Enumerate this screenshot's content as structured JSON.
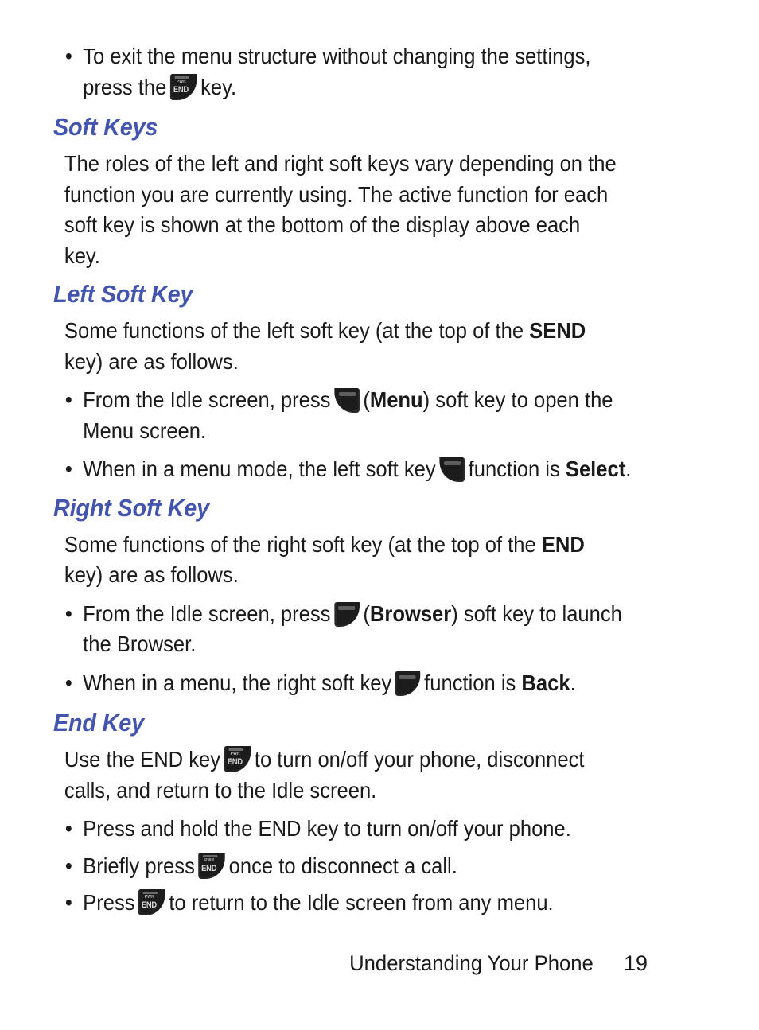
{
  "document": {
    "page_number": "19",
    "footer_title": "Understanding Your Phone",
    "heading_color": "#4455b0",
    "body_color": "#1a1a1a",
    "background_color": "#ffffff"
  },
  "intro_bullet": {
    "text_before": "To exit the menu structure without changing the settings, press the",
    "icon": "end-key-icon",
    "text_after": "key."
  },
  "sections": [
    {
      "id": "soft-keys",
      "heading": "Soft Keys",
      "paragraph": "The roles of the left and right soft keys vary depending on the function you are currently using. The active function for each soft key is shown at the bottom of the display above each key."
    },
    {
      "id": "left-soft-key",
      "heading": "Left Soft Key",
      "paragraph_part1": "Some functions of the left soft key (at the top of the ",
      "paragraph_bold": "SEND",
      "paragraph_part2": " key) are as follows.",
      "bullets": [
        {
          "text_before": "From the Idle screen, press",
          "icon": "left-soft-key-icon",
          "text_mid_open": "(",
          "bold": "Menu",
          "text_after": ") soft key to open the Menu screen."
        },
        {
          "text_before": "When in a menu mode, the left soft key",
          "icon": "left-soft-key-icon",
          "text_mid": "function is",
          "bold": "Select",
          "text_after": "."
        }
      ]
    },
    {
      "id": "right-soft-key",
      "heading": "Right Soft Key",
      "paragraph_part1": "Some functions of the right soft key (at the top of the ",
      "paragraph_bold": "END",
      "paragraph_part2": " key) are as follows.",
      "bullets": [
        {
          "text_before": "From the Idle screen, press",
          "icon": "right-soft-key-icon",
          "text_mid_open": "(",
          "bold": "Browser",
          "text_after": ") soft key to launch the Browser."
        },
        {
          "text_before": "When in a menu, the right soft key",
          "icon": "right-soft-key-icon",
          "text_mid": "function is",
          "bold": "Back",
          "text_after": "."
        }
      ]
    },
    {
      "id": "end-key",
      "heading": "End Key",
      "paragraph_part1": "Use the END key",
      "paragraph_icon": "end-key-icon",
      "paragraph_part2": "to turn on/off your phone, disconnect calls, and return to the Idle screen.",
      "bullets": [
        {
          "text_only": "Press and hold the END key to turn on/off your phone."
        },
        {
          "text_before": "Briefly press",
          "icon": "end-key-icon",
          "text_after": "once to disconnect a call."
        },
        {
          "text_before": "Press",
          "icon": "end-key-icon",
          "text_after": "to return to the Idle screen from any menu."
        }
      ]
    }
  ],
  "icons": {
    "end_key_top_label": "PWR",
    "end_key_main_label": "END"
  }
}
